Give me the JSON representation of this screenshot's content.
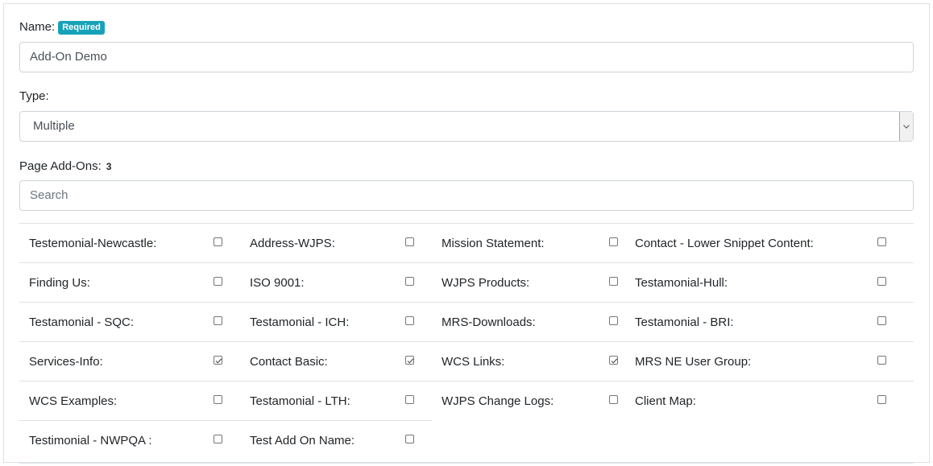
{
  "name_label": "Name:",
  "required_badge": "Required",
  "name_value": "Add-On Demo",
  "type_label": "Type:",
  "type_value": "Multiple",
  "addons_label": "Page Add-Ons:",
  "addons_count": "3",
  "search_placeholder": "Search",
  "addons": [
    {
      "label": "Testemonial-Newcastle:",
      "checked": false
    },
    {
      "label": "Address-WJPS:",
      "checked": false
    },
    {
      "label": "Mission Statement:",
      "checked": false
    },
    {
      "label": "Contact - Lower Snippet Content:",
      "checked": false
    },
    {
      "label": "Finding Us:",
      "checked": false
    },
    {
      "label": "ISO 9001:",
      "checked": false
    },
    {
      "label": "WJPS Products:",
      "checked": false
    },
    {
      "label": "Testamonial-Hull:",
      "checked": false
    },
    {
      "label": "Testamonial - SQC:",
      "checked": false
    },
    {
      "label": "Testamonial - ICH:",
      "checked": false
    },
    {
      "label": "MRS-Downloads:",
      "checked": false
    },
    {
      "label": "Testamonial - BRI:",
      "checked": false
    },
    {
      "label": "Services-Info:",
      "checked": true
    },
    {
      "label": "Contact Basic:",
      "checked": true
    },
    {
      "label": "WCS Links:",
      "checked": true
    },
    {
      "label": "MRS NE User Group:",
      "checked": false
    },
    {
      "label": "WCS Examples:",
      "checked": false
    },
    {
      "label": "Testamonial - LTH:",
      "checked": false
    },
    {
      "label": "WJPS Change Logs:",
      "checked": false
    },
    {
      "label": "Client Map:",
      "checked": false
    },
    {
      "label": "Testimonial - NWPQA :",
      "checked": false
    },
    {
      "label": "Test Add On Name:",
      "checked": false
    }
  ]
}
